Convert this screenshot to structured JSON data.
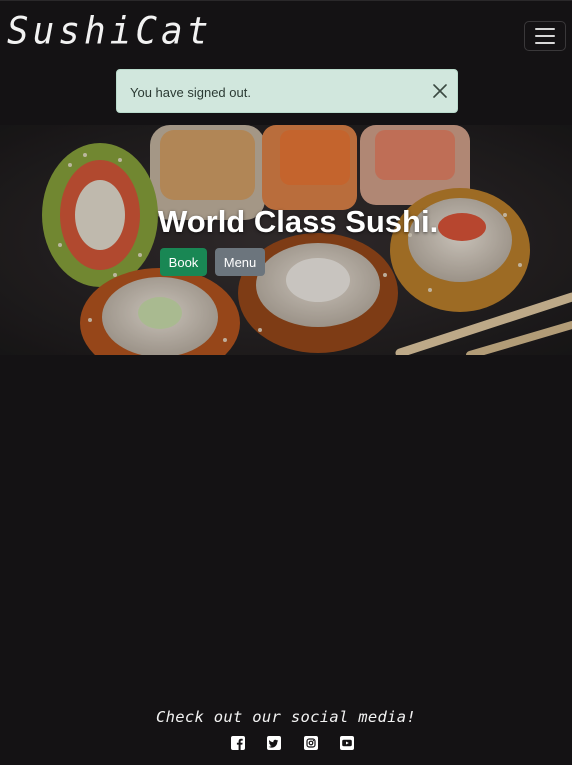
{
  "navbar": {
    "brand": "SushiCat",
    "toggle_icon": "hamburger-icon"
  },
  "alert": {
    "message": "You have signed out.",
    "close_icon": "close-icon",
    "background": "#d1e7dd"
  },
  "hero": {
    "title": "World Class Sushi.",
    "book_label": "Book",
    "menu_label": "Menu",
    "book_color": "#198754",
    "menu_color": "#6c757d"
  },
  "footer": {
    "text": "Check out our social media!",
    "icons": [
      "facebook-icon",
      "twitter-icon",
      "instagram-icon",
      "youtube-icon"
    ]
  },
  "theme": {
    "background": "#141214",
    "text": "#f2f2f2"
  }
}
